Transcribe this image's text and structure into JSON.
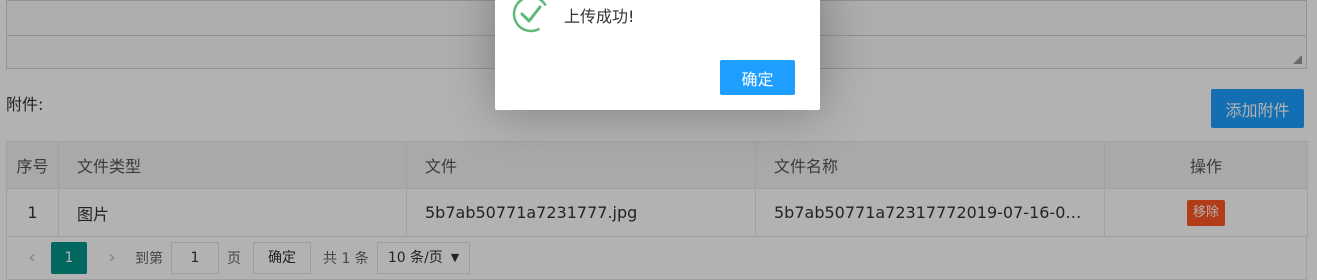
{
  "attachments": {
    "label": "附件:",
    "add_button": "添加附件"
  },
  "table": {
    "headers": [
      "序号",
      "文件类型",
      "文件",
      "文件名称",
      "操作"
    ],
    "rows": [
      {
        "index": "1",
        "type": "图片",
        "file": "5b7ab50771a7231777.jpg",
        "name": "5b7ab50771a72317772019-07-16-09…",
        "action": "移除"
      }
    ]
  },
  "pagination": {
    "current_page": "1",
    "goto_label": "到第",
    "page_input": "1",
    "page_unit": "页",
    "confirm": "确定",
    "total": "共 1 条",
    "page_size": "10 条/页"
  },
  "dialog": {
    "message": "上传成功!",
    "ok_button": "确定",
    "icon": "success-check-icon"
  },
  "colors": {
    "primary": "#1e9fff",
    "danger": "#ff5722",
    "pager_active": "#009688",
    "success": "#5fb878"
  }
}
